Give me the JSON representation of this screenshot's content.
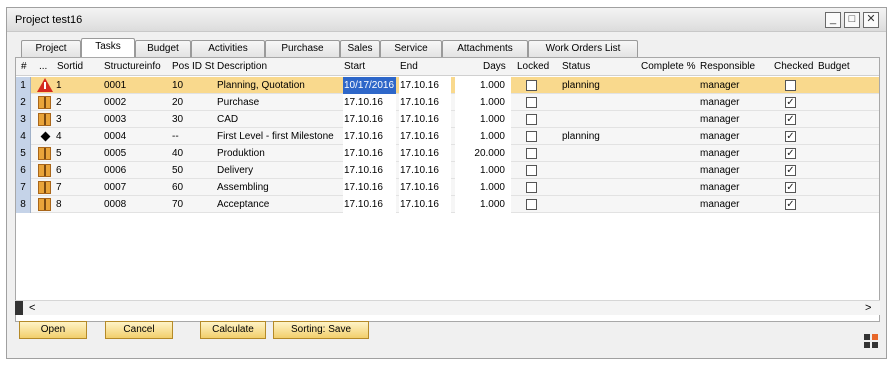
{
  "window": {
    "title": "Project test16",
    "minimize": "_",
    "maximize": "□",
    "close": "✕"
  },
  "tabs": [
    "Project",
    "Tasks",
    "Budget",
    "Activities",
    "Purchase",
    "Sales",
    "Service",
    "Attachments",
    "Work Orders List"
  ],
  "columns": {
    "num": "#",
    "dots": "...",
    "sortid": "Sortid",
    "structure": "Structureinfo",
    "posid": "Pos ID St",
    "desc": "Description",
    "start": "Start",
    "end": "End",
    "days": "Days",
    "locked": "Locked",
    "status": "Status",
    "complete": "Complete %",
    "responsible": "Responsible",
    "checked": "Checked",
    "budget": "Budget"
  },
  "rows": [
    {
      "num": "1",
      "sortid": "1",
      "structure": "0001",
      "posid": "10",
      "desc": "Planning, Quotation",
      "start": "10/17/2016",
      "end": "17.10.16",
      "days": "1.000",
      "status": "planning",
      "responsible": "manager",
      "checked": false,
      "icon": "warning-icon"
    },
    {
      "num": "2",
      "sortid": "2",
      "structure": "0002",
      "posid": "20",
      "desc": "Purchase",
      "start": "17.10.16",
      "end": "17.10.16",
      "days": "1.000",
      "status": "",
      "responsible": "manager",
      "checked": true,
      "icon": "box-icon"
    },
    {
      "num": "3",
      "sortid": "3",
      "structure": "0003",
      "posid": "30",
      "desc": "CAD",
      "start": "17.10.16",
      "end": "17.10.16",
      "days": "1.000",
      "status": "",
      "responsible": "manager",
      "checked": true,
      "icon": "box-icon"
    },
    {
      "num": "4",
      "sortid": "4",
      "structure": "0004",
      "posid": "--",
      "desc": "First Level - first Milestone",
      "start": "17.10.16",
      "end": "17.10.16",
      "days": "1.000",
      "status": "planning",
      "responsible": "manager",
      "checked": true,
      "icon": "milestone-icon"
    },
    {
      "num": "5",
      "sortid": "5",
      "structure": "0005",
      "posid": "40",
      "desc": "Produktion",
      "start": "17.10.16",
      "end": "17.10.16",
      "days": "20.000",
      "status": "",
      "responsible": "manager",
      "checked": true,
      "icon": "box-icon"
    },
    {
      "num": "6",
      "sortid": "6",
      "structure": "0006",
      "posid": "50",
      "desc": "Delivery",
      "start": "17.10.16",
      "end": "17.10.16",
      "days": "1.000",
      "status": "",
      "responsible": "manager",
      "checked": true,
      "icon": "box-icon"
    },
    {
      "num": "7",
      "sortid": "7",
      "structure": "0007",
      "posid": "60",
      "desc": "Assembling",
      "start": "17.10.16",
      "end": "17.10.16",
      "days": "1.000",
      "status": "",
      "responsible": "manager",
      "checked": true,
      "icon": "box-icon"
    },
    {
      "num": "8",
      "sortid": "8",
      "structure": "0008",
      "posid": "70",
      "desc": "Acceptance",
      "start": "17.10.16",
      "end": "17.10.16",
      "days": "1.000",
      "status": "",
      "responsible": "manager",
      "checked": true,
      "icon": "box-icon"
    }
  ],
  "buttons": {
    "open": "Open",
    "cancel": "Cancel",
    "calculate": "Calculate",
    "sorting": "Sorting: Save"
  },
  "scroll": {
    "left": "<",
    "right": ">"
  },
  "colors": {
    "selected_row": "#f9d98d",
    "button": "#f2cf6c",
    "selection": "#2e67c9"
  }
}
